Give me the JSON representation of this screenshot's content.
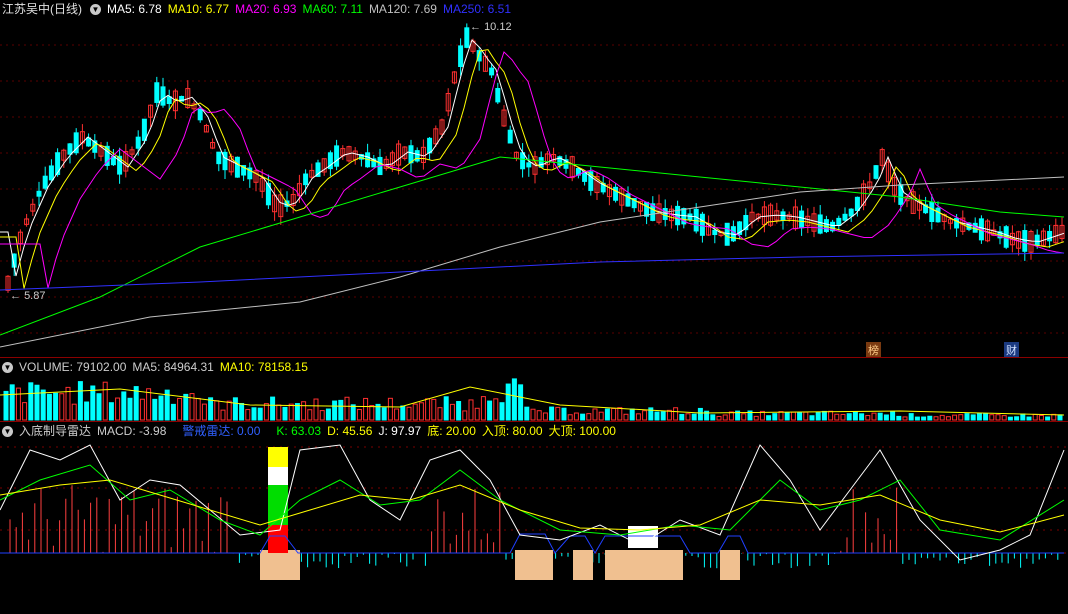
{
  "price_panel": {
    "title": "江苏吴中(日线)",
    "ma_labels": [
      {
        "text": "MA5: 6.78",
        "color": "#ffffff"
      },
      {
        "text": "MA10: 6.77",
        "color": "#ffff00"
      },
      {
        "text": "MA20: 6.93",
        "color": "#ff00ff"
      },
      {
        "text": "MA60: 7.11",
        "color": "#00ff00"
      },
      {
        "text": "MA120: 7.69",
        "color": "#c0c0c0"
      },
      {
        "text": "MA250: 6.51",
        "color": "#3030ff"
      }
    ],
    "high_label": "10.12",
    "low_label": "5.87",
    "markers": [
      {
        "text": "榜",
        "color": "#ff8040"
      },
      {
        "text": "财",
        "color": "#6fa8ff"
      }
    ]
  },
  "volume_panel": {
    "labels": [
      {
        "text": "VOLUME: 79102.00",
        "color": "#cccccc"
      },
      {
        "text": "MA5: 84964.31",
        "color": "#cccccc"
      },
      {
        "text": "MA10: 78158.15",
        "color": "#ffff00"
      }
    ]
  },
  "indicator_panel": {
    "title": "入底制导雷达",
    "labels": [
      {
        "text": "MACD: -3.98",
        "color": "#cccccc"
      },
      {
        "text": "警戒雷达: 0.00",
        "color": "#3060ff"
      },
      {
        "text": "K: 63.03",
        "color": "#00ff00"
      },
      {
        "text": "D: 45.56",
        "color": "#ffff00"
      },
      {
        "text": "J: 97.97",
        "color": "#ffffff"
      },
      {
        "text": "底: 20.00",
        "color": "#ffff00"
      },
      {
        "text": "入顶: 80.00",
        "color": "#ffff00"
      },
      {
        "text": "大顶: 100.00",
        "color": "#ffff00"
      }
    ]
  },
  "colors": {
    "up": "#ff3030",
    "down": "#00ffff",
    "grid": "#8b0000",
    "background": "#000000"
  },
  "icons": [
    "collapse-icon"
  ]
}
